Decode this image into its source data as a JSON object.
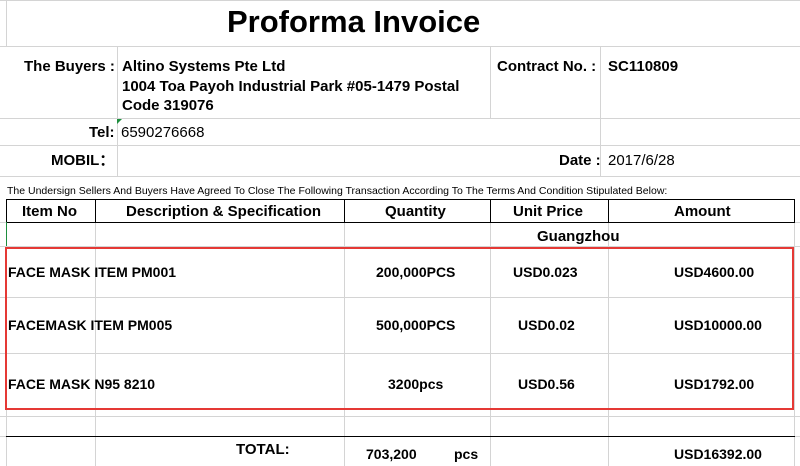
{
  "title": "Proforma Invoice",
  "buyers": {
    "label": "The Buyers :",
    "name": "Altino Systems Pte Ltd",
    "address_line1": "1004 Toa Payoh Industrial Park #05-1479 Postal",
    "address_line2": "Code  319076"
  },
  "contract": {
    "label": "Contract No. :",
    "value": "SC110809"
  },
  "tel": {
    "label": "Tel:",
    "value": "6590276668"
  },
  "mobil": {
    "label": "MOBIL："
  },
  "date": {
    "label": "Date :",
    "value": "2017/6/28"
  },
  "agreement_text": "The Undersign Sellers And Buyers Have Agreed To Close The Following Transaction According To The Terms And Condition Stipulated Below:",
  "table": {
    "headers": {
      "item_no": "Item No",
      "description": "Description & Specification",
      "quantity": "Quantity",
      "unit_price": "Unit Price",
      "amount": "Amount"
    },
    "location": "Guangzhou",
    "rows": [
      {
        "description": "FACE MASK ITEM PM001",
        "quantity": "200,000PCS",
        "unit_price": "USD0.023",
        "amount": "USD4600.00"
      },
      {
        "description": "FACEMASK ITEM PM005",
        "quantity": "500,000PCS",
        "unit_price": "USD0.02",
        "amount": "USD10000.00"
      },
      {
        "description": "FACE MASK N95  8210",
        "quantity": "3200pcs",
        "unit_price": "USD0.56",
        "amount": "USD1792.00"
      }
    ],
    "total": {
      "label": "TOTAL:",
      "quantity": "703,200",
      "unit": "pcs",
      "amount": "USD16392.00"
    }
  },
  "colors": {
    "selection_border": "#e53935",
    "gridline": "#d4d4d4",
    "comment_marker": "#1e8e3e"
  }
}
